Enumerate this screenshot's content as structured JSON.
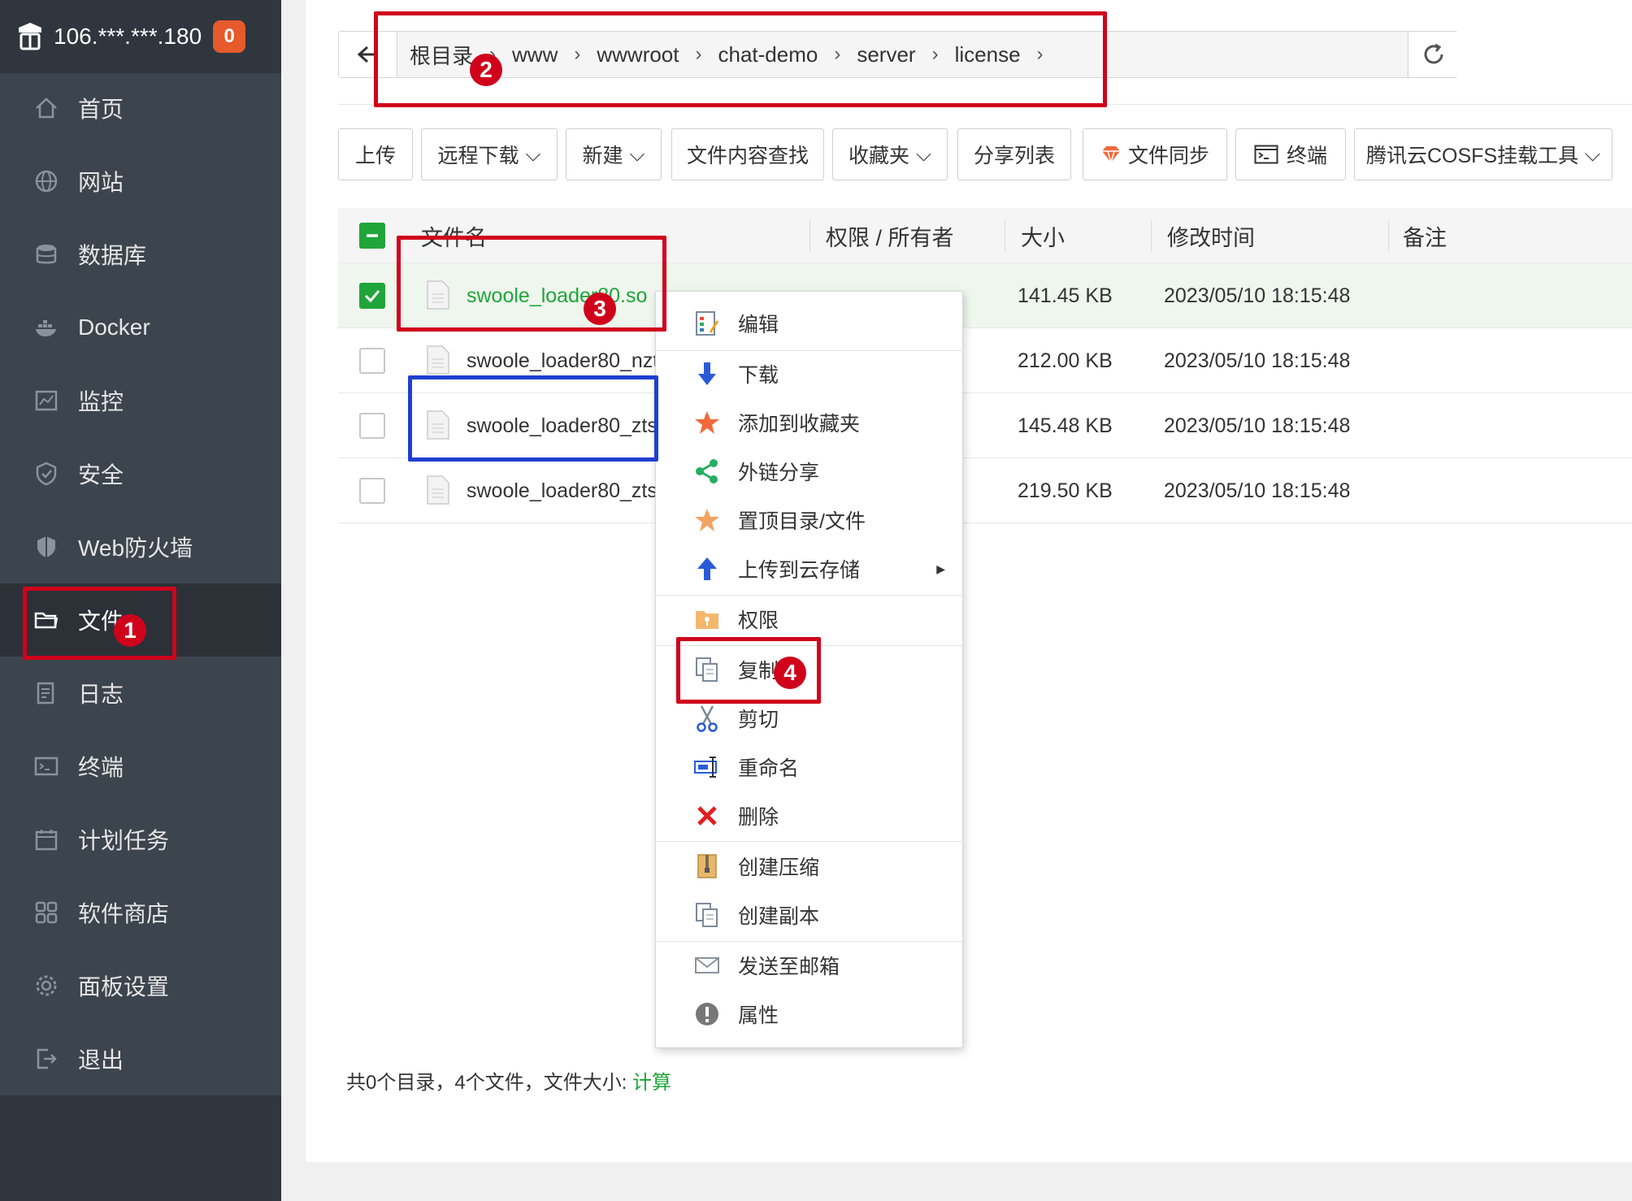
{
  "sidebar": {
    "server_ip": "106.***.***.180",
    "badge_count": "0",
    "items": [
      {
        "label": "首页",
        "icon": "home-icon"
      },
      {
        "label": "网站",
        "icon": "globe-icon"
      },
      {
        "label": "数据库",
        "icon": "database-icon"
      },
      {
        "label": "Docker",
        "icon": "docker-icon"
      },
      {
        "label": "监控",
        "icon": "monitor-icon"
      },
      {
        "label": "安全",
        "icon": "shield-icon"
      },
      {
        "label": "Web防火墙",
        "icon": "firewall-icon"
      },
      {
        "label": "文件",
        "icon": "folder-icon",
        "active": true
      },
      {
        "label": "日志",
        "icon": "log-icon"
      },
      {
        "label": "终端",
        "icon": "terminal-icon"
      },
      {
        "label": "计划任务",
        "icon": "calendar-icon"
      },
      {
        "label": "软件商店",
        "icon": "apps-icon"
      },
      {
        "label": "面板设置",
        "icon": "gear-icon"
      },
      {
        "label": "退出",
        "icon": "logout-icon"
      }
    ]
  },
  "path": {
    "crumbs": [
      "根目录",
      "www",
      "wwwroot",
      "chat-demo",
      "server",
      "license"
    ]
  },
  "toolbar": {
    "upload": "上传",
    "remote_download": "远程下载",
    "new": "新建",
    "content_search": "文件内容查找",
    "favorites": "收藏夹",
    "share_list": "分享列表",
    "file_sync": "文件同步",
    "terminal": "终端",
    "cosfs": "腾讯云COSFS挂载工具"
  },
  "table": {
    "headers": {
      "name": "文件名",
      "perm": "权限 / 所有者",
      "size": "大小",
      "mtime": "修改时间",
      "note": "备注"
    },
    "rows": [
      {
        "name": "swoole_loader80.so",
        "size": "141.45 KB",
        "mtime": "2023/05/10 18:15:48",
        "checked": true
      },
      {
        "name": "swoole_loader80_nzt",
        "size": "212.00 KB",
        "mtime": "2023/05/10 18:15:48",
        "checked": false
      },
      {
        "name": "swoole_loader80_zts",
        "size": "145.48 KB",
        "mtime": "2023/05/10 18:15:48",
        "checked": false
      },
      {
        "name": "swoole_loader80_zts",
        "size": "219.50 KB",
        "mtime": "2023/05/10 18:15:48",
        "checked": false
      }
    ]
  },
  "context_menu": {
    "items": [
      {
        "label": "编辑",
        "icon": "edit-icon"
      },
      {
        "label": "下载",
        "icon": "download-icon"
      },
      {
        "label": "添加到收藏夹",
        "icon": "star-icon"
      },
      {
        "label": "外链分享",
        "icon": "share-icon"
      },
      {
        "label": "置顶目录/文件",
        "icon": "pin-icon"
      },
      {
        "label": "上传到云存储",
        "icon": "cloud-upload-icon",
        "submenu": true
      },
      {
        "label": "权限",
        "icon": "permission-icon"
      },
      {
        "label": "复制",
        "icon": "copy-icon"
      },
      {
        "label": "剪切",
        "icon": "scissors-icon"
      },
      {
        "label": "重命名",
        "icon": "rename-icon"
      },
      {
        "label": "删除",
        "icon": "delete-icon"
      },
      {
        "label": "创建压缩",
        "icon": "zip-icon"
      },
      {
        "label": "创建副本",
        "icon": "duplicate-icon"
      },
      {
        "label": "发送至邮箱",
        "icon": "mail-icon"
      },
      {
        "label": "属性",
        "icon": "info-icon"
      }
    ]
  },
  "footer": {
    "summary": "共0个目录，4个文件，文件大小: ",
    "calc_link": "计算"
  },
  "annotations": [
    "1",
    "2",
    "3",
    "4"
  ],
  "colors": {
    "accent_green": "#20a53a",
    "sidebar_bg": "#3c444d",
    "annotation_red": "#d0021b",
    "annotation_blue": "#1f3fd0"
  }
}
